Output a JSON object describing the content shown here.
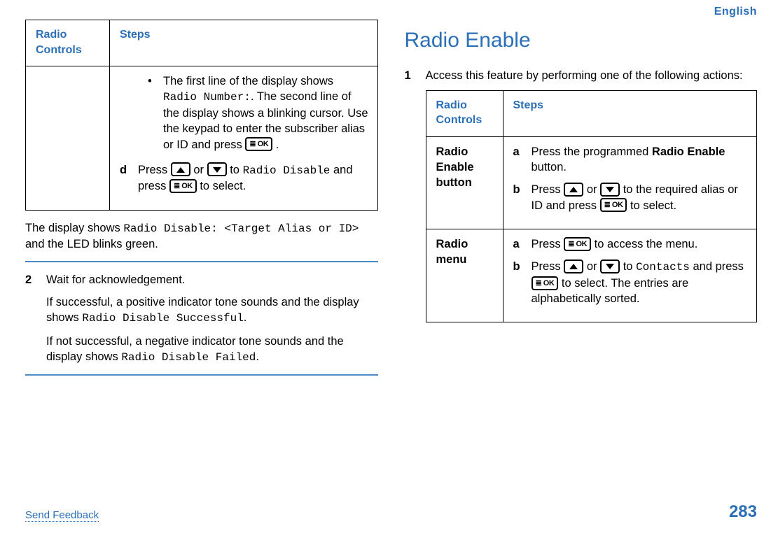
{
  "header": {
    "language": "English"
  },
  "left": {
    "table": {
      "headers": {
        "col1": "Radio Controls",
        "col2": "Steps"
      },
      "bullet": {
        "pre": "The first line of the display shows ",
        "code1": "Radio Number:",
        "post1": ". The second line of the display shows a blinking cursor. Use the keypad to enter the subscriber alias or ID and press ",
        "post2": " ."
      },
      "step_d": {
        "letter": "d",
        "t1": "Press ",
        "t2": " or ",
        "t3": " to ",
        "code1": "Radio Disable",
        "t4": " and press ",
        "t5": " to select."
      }
    },
    "after_table": {
      "t1": "The display shows ",
      "code1": "Radio Disable: <Target Alias or ID>",
      "t2": " and the LED blinks green."
    },
    "step2": {
      "num": "2",
      "line1": "Wait for acknowledgement.",
      "p2a": "If successful, a positive indicator tone sounds and the display shows ",
      "p2code": "Radio Disable Successful",
      "p2b": ".",
      "p3a": "If not successful, a negative indicator tone sounds and the display shows ",
      "p3code": "Radio Disable Failed",
      "p3b": "."
    }
  },
  "right": {
    "heading": "Radio Enable",
    "step1": {
      "num": "1",
      "text": "Access this feature by performing one of the following actions:"
    },
    "table": {
      "headers": {
        "col1": "Radio Controls",
        "col2": "Steps"
      },
      "row1": {
        "label": "Radio Enable button",
        "a": {
          "letter": "a",
          "t1": "Press the programmed ",
          "bold": "Radio Enable",
          "t2": " button."
        },
        "b": {
          "letter": "b",
          "t1": "Press ",
          "t2": " or ",
          "t3": " to the required alias or ID and press ",
          "t4": " to select."
        }
      },
      "row2": {
        "label": "Radio menu",
        "a": {
          "letter": "a",
          "t1": "Press ",
          "t2": " to access the menu."
        },
        "b": {
          "letter": "b",
          "t1": "Press ",
          "t2": " or ",
          "t3": " to ",
          "code": "Contacts",
          "t4": " and press ",
          "t5": " to select. The entries are alphabetically sorted."
        }
      }
    }
  },
  "footer": {
    "feedback": "Send Feedback",
    "page": "283"
  }
}
